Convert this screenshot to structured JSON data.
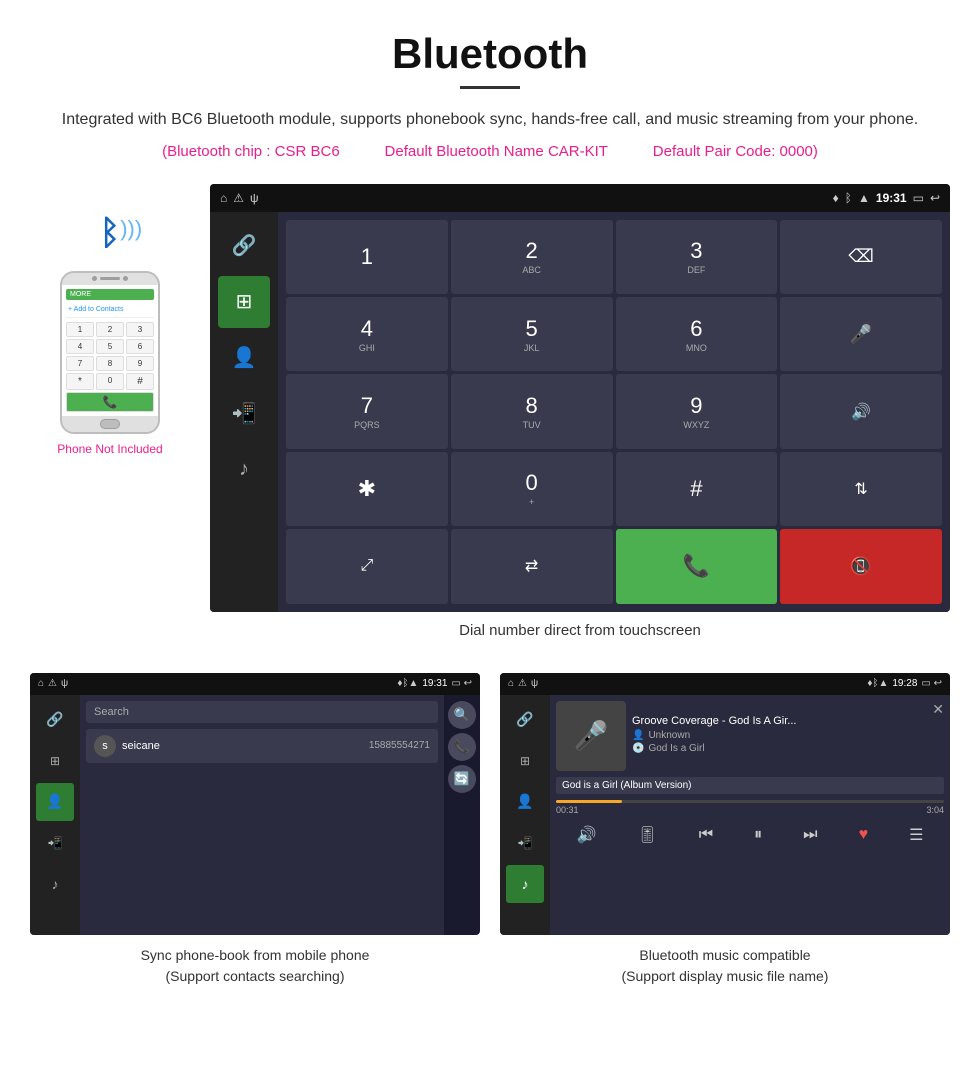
{
  "header": {
    "title": "Bluetooth",
    "description": "Integrated with BC6 Bluetooth module, supports phonebook sync, hands-free call, and music streaming from your phone.",
    "specs": {
      "chip": "(Bluetooth chip : CSR BC6",
      "name": "Default Bluetooth Name CAR-KIT",
      "code": "Default Pair Code: 0000)"
    }
  },
  "phone_label": "Phone Not Included",
  "dialpad": {
    "caption": "Dial number direct from touchscreen",
    "status_time": "19:31",
    "keys": [
      {
        "main": "1",
        "sub": ""
      },
      {
        "main": "2",
        "sub": "ABC"
      },
      {
        "main": "3",
        "sub": "DEF"
      },
      {
        "main": "⌫",
        "sub": ""
      },
      {
        "main": "4",
        "sub": "GHI"
      },
      {
        "main": "5",
        "sub": "JKL"
      },
      {
        "main": "6",
        "sub": "MNO"
      },
      {
        "main": "🎤",
        "sub": ""
      },
      {
        "main": "7",
        "sub": "PQRS"
      },
      {
        "main": "8",
        "sub": "TUV"
      },
      {
        "main": "9",
        "sub": "WXYZ"
      },
      {
        "main": "🔊",
        "sub": ""
      },
      {
        "main": "★",
        "sub": ""
      },
      {
        "main": "0",
        "sub": "+"
      },
      {
        "main": "#",
        "sub": ""
      },
      {
        "main": "⇅",
        "sub": ""
      },
      {
        "main": "⤢",
        "sub": ""
      },
      {
        "main": "⇄",
        "sub": ""
      },
      {
        "main": "📞",
        "sub": ""
      },
      {
        "main": "📵",
        "sub": ""
      }
    ]
  },
  "phonebook": {
    "caption": "Sync phone-book from mobile phone\n(Support contacts searching)",
    "status_time": "19:31",
    "search_placeholder": "Search",
    "contact": {
      "initial": "s",
      "name": "seicane",
      "number": "15885554271"
    }
  },
  "music": {
    "caption": "Bluetooth music compatible\n(Support display music file name)",
    "status_time": "19:28",
    "song_title": "Groove Coverage - God Is A Gir...",
    "meta1": "Unknown",
    "meta2": "God Is a Girl",
    "meta3": "God is a Girl (Album Version)",
    "progress_current": "00:31",
    "progress_total": "3:04"
  },
  "icons": {
    "bluetooth": "ᛒ",
    "phone": "📞",
    "chain": "🔗",
    "dialpad": "⌨",
    "person": "👤",
    "transfer": "🔀",
    "music": "🎵",
    "search": "🔍",
    "call": "📞",
    "refresh": "🔄"
  }
}
